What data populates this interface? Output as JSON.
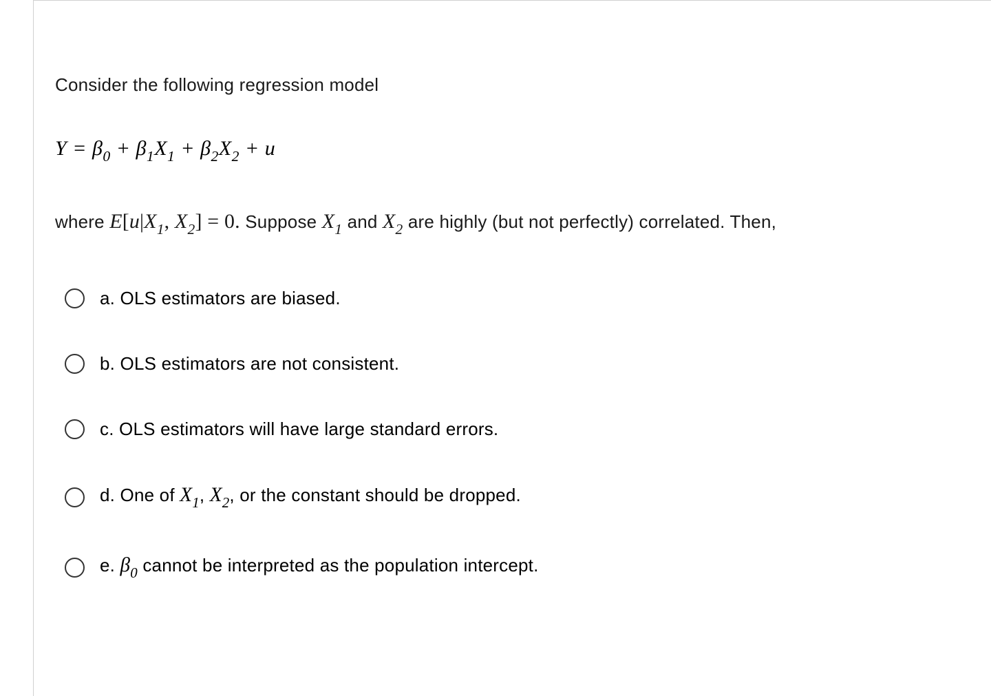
{
  "question": {
    "prompt": "Consider the following regression model",
    "equation_parts": {
      "Y": "Y",
      "eq": " = ",
      "b0": "β",
      "b0_sub": "0",
      "plus1": " + ",
      "b1": "β",
      "b1_sub": "1",
      "x1": "X",
      "x1_sub": "1",
      "plus2": " + ",
      "b2": "β",
      "b2_sub": "2",
      "x2": "X",
      "x2_sub": "2",
      "plus3": " + ",
      "u": "u"
    },
    "where": {
      "prefix": "where ",
      "expectation_E": "E",
      "expectation_bracket_open": "[",
      "expectation_u": "u",
      "expectation_bar": "|",
      "expectation_X1": "X",
      "expectation_X1_sub": "1",
      "expectation_comma": ", ",
      "expectation_X2": "X",
      "expectation_X2_sub": "2",
      "expectation_bracket_close": "]",
      "expectation_eq": " = 0.",
      "mid1": " Suppose ",
      "x1": "X",
      "x1_sub": "1",
      "mid2": " and ",
      "x2": "X",
      "x2_sub": "2",
      "suffix": " are highly (but not perfectly) correlated. Then,"
    },
    "options": {
      "a": {
        "label": "a.",
        "text": " OLS estimators are biased."
      },
      "b": {
        "label": "b.",
        "text": " OLS estimators are not consistent."
      },
      "c": {
        "label": "c.",
        "text": " OLS estimators will have large standard errors."
      },
      "d": {
        "label": "d.",
        "pre": " One of ",
        "x1": "X",
        "x1_sub": "1",
        "comma": ", ",
        "x2": "X",
        "x2_sub": "2",
        "comma2": ",",
        "post": " or the constant should be dropped."
      },
      "e": {
        "label": "e.",
        "space": " ",
        "b0": "β",
        "b0_sub": "0",
        "post": " cannot be interpreted as the population intercept."
      }
    }
  }
}
